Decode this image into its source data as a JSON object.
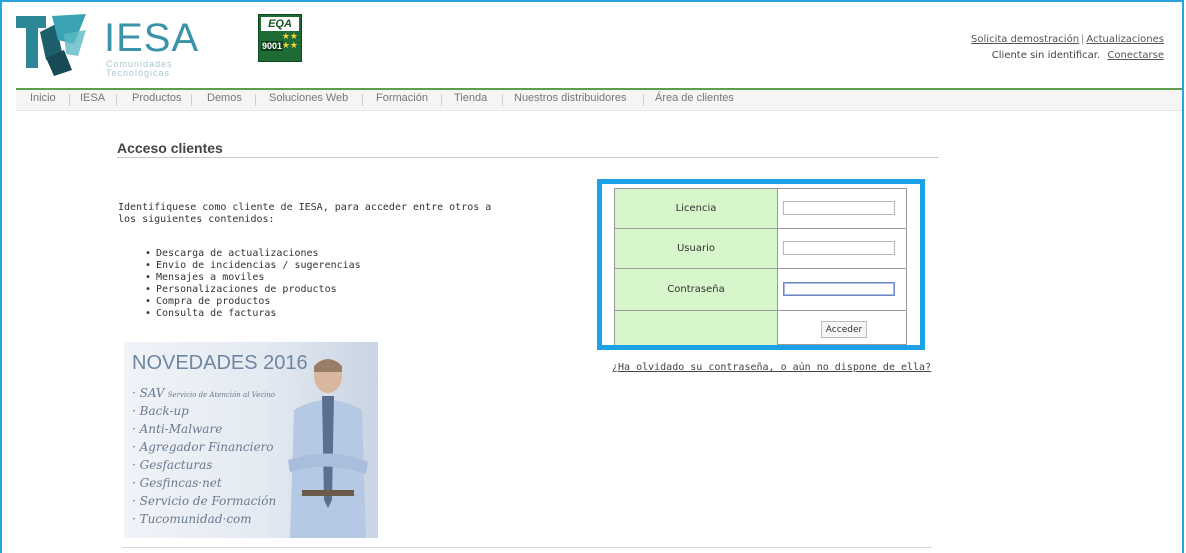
{
  "brand": {
    "name": "IESA",
    "tagline_line1": "Comunidades",
    "tagline_line2": "Tecnológicas",
    "cert_logo": "EQA",
    "cert_number": "9001",
    "colors": {
      "accent": "#29a3dc",
      "nav_rule": "#5d9d4c",
      "highlight_border": "#1aa1e6",
      "label_bg": "#d8f6cc"
    }
  },
  "toplinks": {
    "demo": "Solicita demostración",
    "updates": "Actualizaciones",
    "status": "Cliente sin identificar.",
    "connect": "Conectarse"
  },
  "nav": [
    "Inicio",
    "IESA",
    "Productos",
    "Demos",
    "Soluciones Web",
    "Formación",
    "Tienda",
    "Nuestros distribuidores",
    "Área de clientes"
  ],
  "page": {
    "title": "Acceso clientes",
    "intro": "Identifiquese como cliente de IESA, para acceder entre otros a los siguientes contenidos:",
    "bullets": [
      "Descarga de actualizaciones",
      "Envio de incidencias / sugerencias",
      "Mensajes a moviles",
      "Personalizaciones de productos",
      "Compra de productos",
      "Consulta de facturas"
    ]
  },
  "promo": {
    "title": "NOVEDADES 2016",
    "items": [
      "SAV",
      "Back-up",
      "Anti-Malware",
      "Agregador Financiero",
      "Gesfacturas",
      "Gesfincas·net",
      "Servicio de Formación",
      "Tucomunidad·com"
    ],
    "sav_detail": "Servicio de Atención al Vecino"
  },
  "login": {
    "license_label": "Licencia",
    "user_label": "Usuario",
    "password_label": "Contraseña",
    "license_value": "",
    "user_value": "",
    "password_value": "",
    "submit_label": "Acceder",
    "forgot": "¿Ha olvidado su contraseña, o aún no dispone de ella?"
  }
}
